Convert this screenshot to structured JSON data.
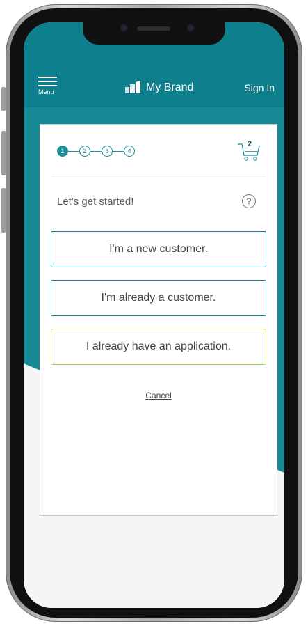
{
  "header": {
    "menu_label": "Menu",
    "brand_name": "My Brand",
    "sign_in_label": "Sign In"
  },
  "progress": {
    "steps": [
      "1",
      "2",
      "3",
      "4"
    ],
    "current_step": 1
  },
  "cart": {
    "count": "2"
  },
  "card": {
    "heading": "Let's get started!",
    "help_icon": "?",
    "options": [
      "I'm a new customer.",
      "I'm already a customer.",
      "I already have an application."
    ],
    "cancel_label": "Cancel"
  },
  "colors": {
    "brand_teal": "#0e7f8c",
    "option_border": "#1a7f8c",
    "option_border_alt": "#9ccf4f"
  }
}
